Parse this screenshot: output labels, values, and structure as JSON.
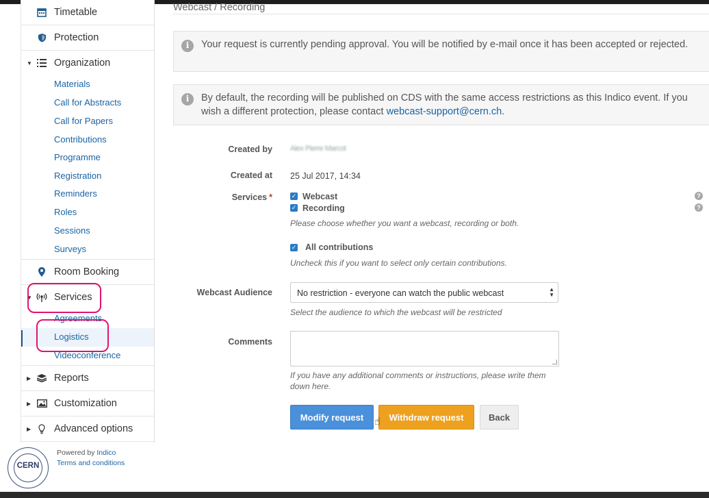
{
  "sidebar": {
    "timetable": "Timetable",
    "protection": "Protection",
    "organization": "Organization",
    "organization_items": [
      "Materials",
      "Call for Abstracts",
      "Call for Papers",
      "Contributions",
      "Programme",
      "Registration",
      "Reminders",
      "Roles",
      "Sessions",
      "Surveys"
    ],
    "room_booking": "Room Booking",
    "services": "Services",
    "services_items": [
      "Agreements",
      "Logistics",
      "Videoconference"
    ],
    "reports": "Reports",
    "customization": "Customization",
    "advanced_options": "Advanced options"
  },
  "footer": {
    "logo_text": "CERN",
    "powered_by": "Powered by",
    "indico": "Indico",
    "terms": "Terms and conditions"
  },
  "main": {
    "breadcrumb": "Webcast / Recording",
    "pending_message": "Your request is currently pending approval. You will be notified by e-mail once it has been accepted or rejected.",
    "cds_message": "By default, the recording will be published on CDS with the same access restrictions as this Indico event. If you wish a different protection, please contact",
    "cds_email": "webcast-support@cern.ch",
    "cds_end": ".",
    "form": {
      "created_by_label": "Created by",
      "created_by_value": "Alex Pierre Marcot",
      "created_at_label": "Created at",
      "created_at_value": "25 Jul 2017, 14:34",
      "services_label": "Services",
      "service_webcast": "Webcast",
      "service_recording": "Recording",
      "services_hint": "Please choose whether you want a webcast, recording or both.",
      "all_contributions": "All contributions",
      "all_contributions_hint": "Uncheck this if you want to select only certain contributions.",
      "audience_label": "Webcast Audience",
      "audience_value": "No restriction - everyone can watch the public webcast",
      "audience_hint": "Select the audience to which the webcast will be restricted",
      "comments_label": "Comments",
      "comments_hint": "If you have any additional comments or instructions, please write them down here."
    },
    "buttons": {
      "modify": "Modify request",
      "withdraw": "Withdraw request",
      "back": "Back"
    }
  },
  "colors": {
    "accent": "#1a64a5",
    "primary_button": "#4a90db",
    "warning_button": "#eda11f",
    "annotation": "#e0136e"
  }
}
